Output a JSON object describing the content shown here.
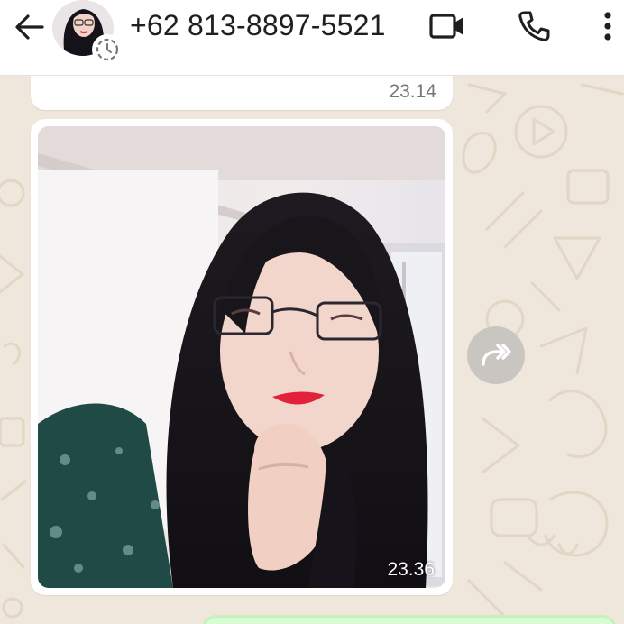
{
  "header": {
    "contact_name": "+62 813-8897-5521",
    "icons": {
      "back": "arrow-left-icon",
      "video": "video-call-icon",
      "voice": "phone-icon",
      "menu": "more-vertical-icon",
      "status": "status-ring-icon"
    }
  },
  "messages": [
    {
      "type": "text",
      "time": "23.14"
    },
    {
      "type": "image",
      "time": "23.36"
    }
  ],
  "colors": {
    "chat_background": "#efe7dc",
    "incoming_bubble": "#ffffff",
    "outgoing_bubble": "#d9fdd3",
    "header": "#ffffff",
    "icon": "#1f1f1f"
  },
  "forward_icon": "forward-icon"
}
